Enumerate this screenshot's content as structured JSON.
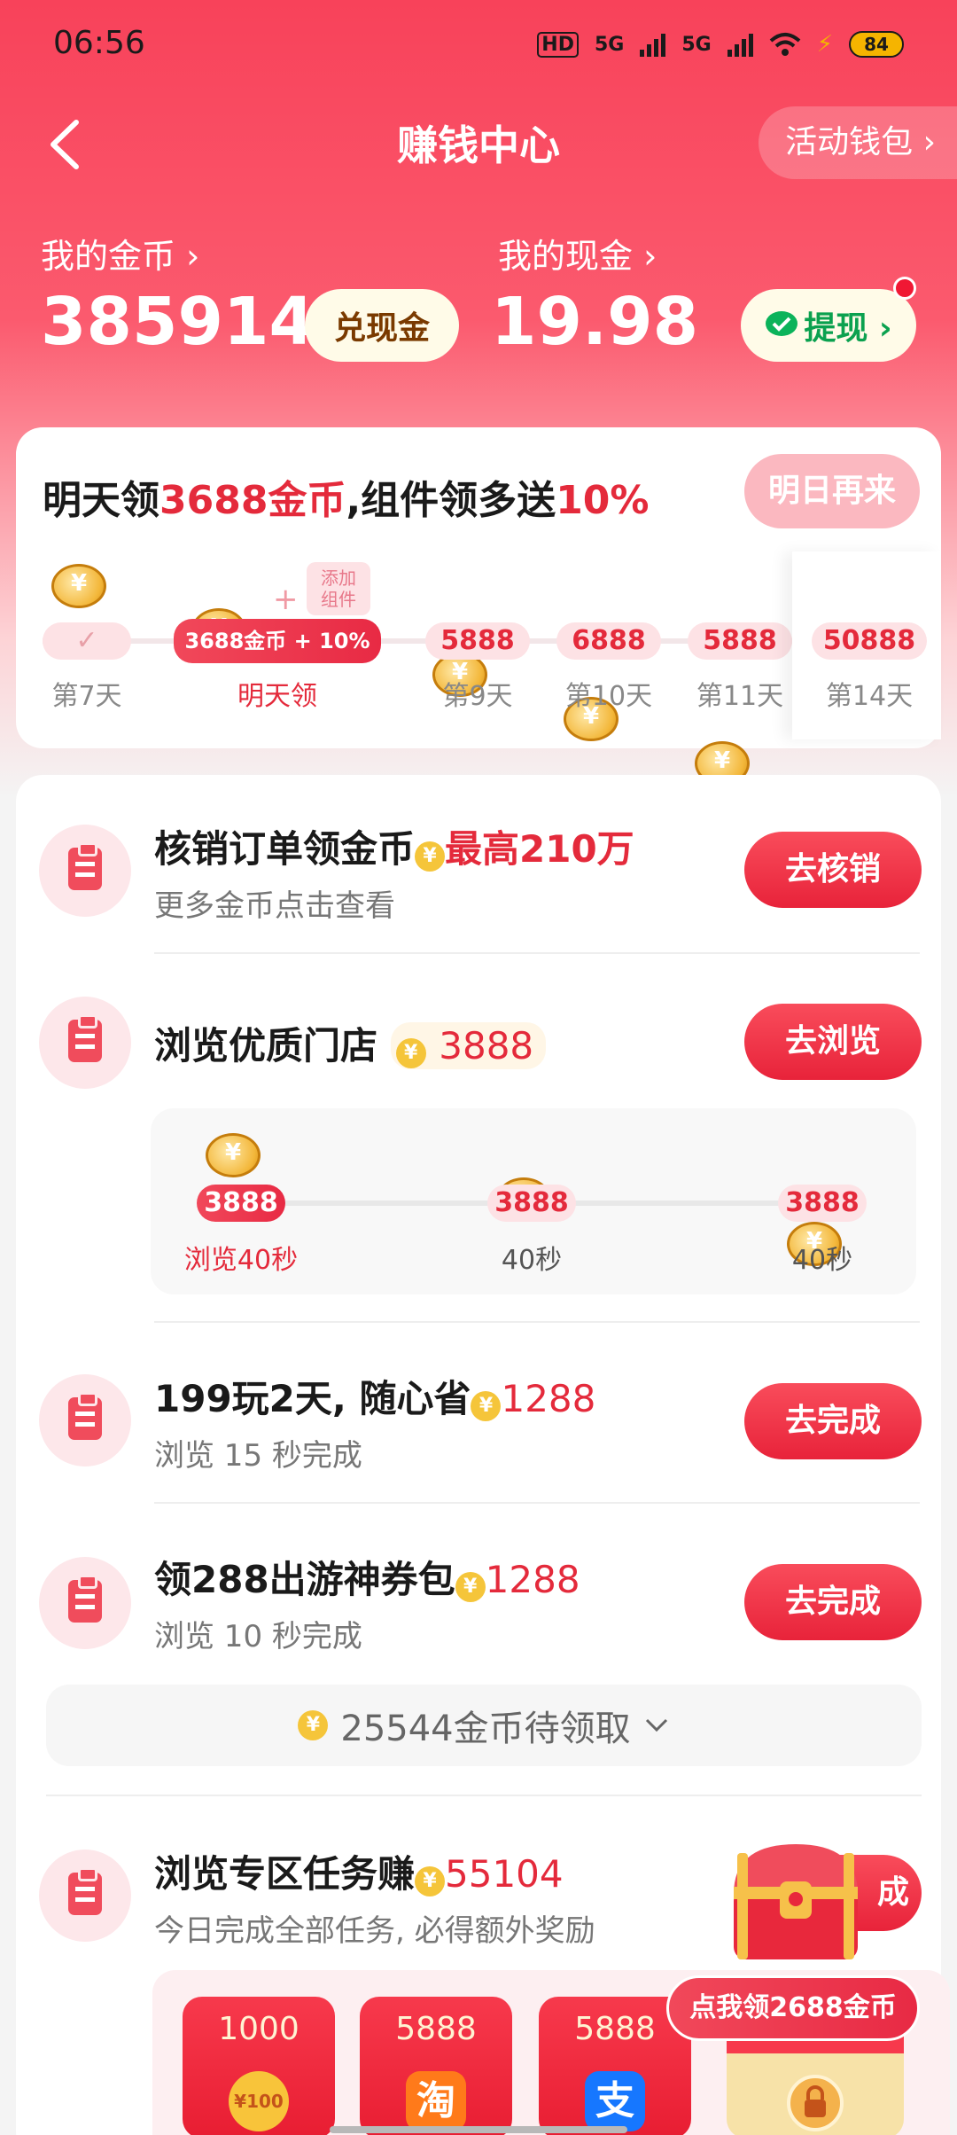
{
  "status_bar": {
    "time": "06:56",
    "network1": "5G",
    "network2": "5G",
    "battery": "84",
    "hd": "HD"
  },
  "header": {
    "title": "赚钱中心",
    "wallet_label": "活动钱包 ›"
  },
  "coins": {
    "label": "我的金币 ›",
    "value": "385914",
    "exchange_label": "兑现金"
  },
  "cash": {
    "label": "我的现金 ›",
    "value": "19.98",
    "withdraw_label": "提现 ›"
  },
  "signin": {
    "headline_pre": "明天领",
    "headline_coins": "3688金币",
    "headline_mid": ",组件领多送",
    "headline_pct": "10%",
    "button_label": "明日再来",
    "widget_tag": "添加组件",
    "plus": "+",
    "check": "✓",
    "days": [
      {
        "amount": "",
        "label": "第7天"
      },
      {
        "amount": "3688金币 + 10%",
        "label": "明天领"
      },
      {
        "amount": "5888",
        "label": "第9天"
      },
      {
        "amount": "6888",
        "label": "第10天"
      },
      {
        "amount": "5888",
        "label": "第11天"
      },
      {
        "amount": "50888",
        "label": "第14天"
      }
    ]
  },
  "tasks": [
    {
      "title": "核销订单领金币",
      "reward": "最高210万",
      "subtitle": "更多金币点击查看",
      "button": "去核销"
    },
    {
      "title": "浏览优质门店",
      "reward": "3888",
      "button": "去浏览"
    },
    {
      "title": "199玩2天, 随心省",
      "reward": "1288",
      "subtitle": "浏览 15 秒完成",
      "button": "去完成"
    },
    {
      "title": "领288出游神券包",
      "reward": "1288",
      "subtitle": "浏览 10 秒完成",
      "button": "去完成"
    },
    {
      "title": "浏览专区任务赚",
      "reward": "55104",
      "subtitle": "今日完成全部任务, 必得额外奖励",
      "button": "成"
    }
  ],
  "browse_progress": [
    {
      "amount": "3888",
      "label": "浏览40秒"
    },
    {
      "amount": "3888",
      "label": "40秒"
    },
    {
      "amount": "3888",
      "label": "40秒"
    }
  ],
  "pending": {
    "label": "25544金币待领取"
  },
  "promo": {
    "label": "点我领2688金币"
  },
  "red_packets": [
    {
      "amount": "1000",
      "icon": "¥100"
    },
    {
      "amount": "5888",
      "icon": "淘"
    },
    {
      "amount": "5888",
      "icon": "支"
    }
  ],
  "colors": {
    "brand_red": "#f8425a",
    "accent": "#e42a3b",
    "coin_gold": "#f3b73a"
  }
}
